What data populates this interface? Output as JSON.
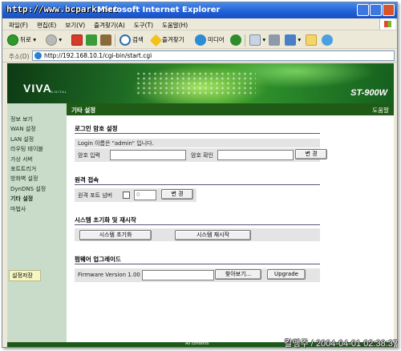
{
  "window": {
    "watermark": "http://www.bcpark.net",
    "title": "Microsoft Internet Explorer"
  },
  "menu": [
    "파일(F)",
    "편집(E)",
    "보기(V)",
    "즐겨찾기(A)",
    "도구(T)",
    "도움말(H)"
  ],
  "toolbar": {
    "back": "뒤로",
    "search": "검색",
    "favorites": "즐겨찾기",
    "media": "미디어"
  },
  "address": {
    "label": "주소(D)",
    "url": "http://192.168.10.1/cgi-bin/start.cgi"
  },
  "banner": {
    "logo": "VIVA",
    "logo_sub": "DIGITAL",
    "model": "ST-900W"
  },
  "sidebar": {
    "items": [
      {
        "label": "정보 보기",
        "active": false
      },
      {
        "label": "WAN 설정",
        "active": false
      },
      {
        "label": "LAN 설정",
        "active": false
      },
      {
        "label": "라우팅 테이블",
        "active": false
      },
      {
        "label": "가상 서버",
        "active": false
      },
      {
        "label": "포트트리거",
        "active": false
      },
      {
        "label": "방화벽 설정",
        "active": false
      },
      {
        "label": "DynDNS 설정",
        "active": false
      },
      {
        "label": "기타 설정",
        "active": true
      },
      {
        "label": "마법사",
        "active": false
      }
    ],
    "save_label": "설정저장"
  },
  "main": {
    "header_title": "기타 설정",
    "help": "도움말",
    "password": {
      "title": "로그인 암호 설정",
      "info": "Login 이름은 \"admin\" 입니다.",
      "pw_label": "암호 입력",
      "confirm_label": "암호 확인",
      "change_button": "변 경"
    },
    "remote": {
      "title": "원격 접속",
      "port_label": "원격 포트 넘버",
      "port_value": "0",
      "change_button": "변 경"
    },
    "system": {
      "title": "시스템 초기화 및 재시작",
      "reset_button": "시스템 초기화",
      "restart_button": "시스템 재시작"
    },
    "firmware": {
      "title": "펌웨어 업그레이드",
      "version": "Firmware Version 1.00",
      "browse_button": "찾아보기...",
      "upgrade_button": "Upgrade"
    }
  },
  "footer": {
    "copyright": "All contents",
    "stamp": "칼맹주 / 2004-04-01 02:38:37"
  }
}
